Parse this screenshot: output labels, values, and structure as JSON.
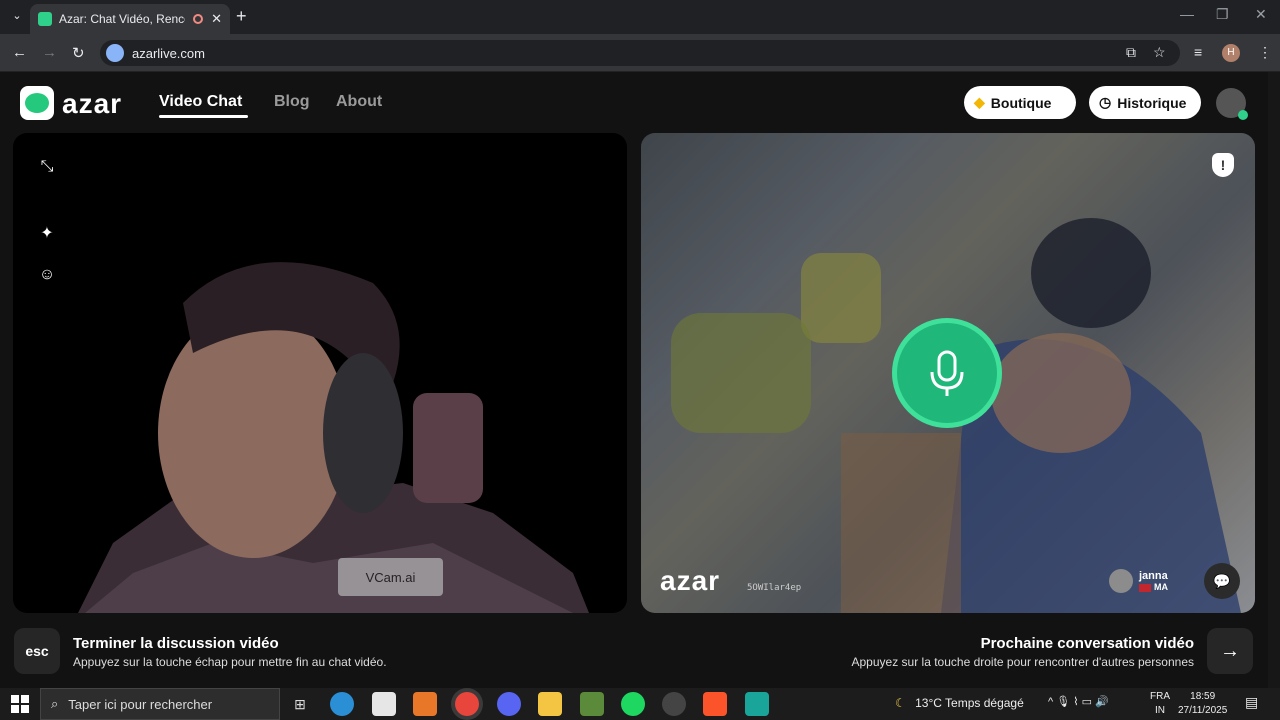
{
  "browser": {
    "tab_title": "Azar: Chat Vidéo, Rencontre",
    "url": "azarlive.com",
    "profile_initial": "H"
  },
  "header": {
    "logo": "azar",
    "nav": [
      "Video Chat",
      "Blog",
      "About"
    ],
    "boutique": "Boutique",
    "historique": "Historique"
  },
  "left_video": {
    "watermark": "VCam.ai"
  },
  "right_video": {
    "logo": "azar",
    "partner_id": "5OWIlar4ep",
    "partner_name": "janna",
    "partner_country": "MA"
  },
  "bottom": {
    "esc_label": "esc",
    "end_title": "Terminer la discussion vidéo",
    "end_sub": "Appuyez sur la touche échap pour mettre fin au chat vidéo.",
    "next_title": "Prochaine conversation vidéo",
    "next_sub": "Appuyez sur la touche droite pour rencontrer d'autres personnes"
  },
  "taskbar": {
    "search_placeholder": "Taper ici pour rechercher",
    "weather": "13°C  Temps dégagé",
    "lang_top": "FRA",
    "lang_bottom": "IN",
    "time": "18:59",
    "date": "27/11/2025"
  },
  "colors": {
    "accent": "#1fb87a",
    "accent_light": "#3ee09a"
  }
}
